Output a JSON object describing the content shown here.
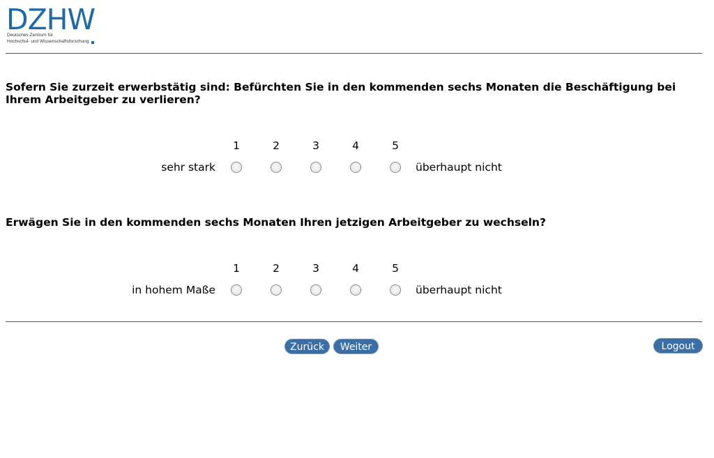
{
  "logo": {
    "wordmark": "DZHW",
    "line1": "Deutsches Zentrum für",
    "line2": "Hochschul- und Wissenschaftsforschung",
    "color": "#1f6aa5"
  },
  "questions": [
    {
      "text": "Sofern Sie zurzeit erwerbstätig sind: Befürchten Sie in den kommenden sechs Monaten die Beschäftigung bei Ihrem Arbeitgeber zu verlieren?",
      "scale": [
        "1",
        "2",
        "3",
        "4",
        "5"
      ],
      "left_label": "sehr stark",
      "right_label": "überhaupt nicht"
    },
    {
      "text": "Erwägen Sie in den kommenden sechs Monaten Ihren jetzigen Arbeitgeber zu wechseln?",
      "scale": [
        "1",
        "2",
        "3",
        "4",
        "5"
      ],
      "left_label": "in hohem Maße",
      "right_label": "überhaupt nicht"
    }
  ],
  "nav": {
    "back_label": "Zurück",
    "next_label": "Weiter",
    "logout_label": "Logout",
    "button_color": "#3a6ea5"
  }
}
